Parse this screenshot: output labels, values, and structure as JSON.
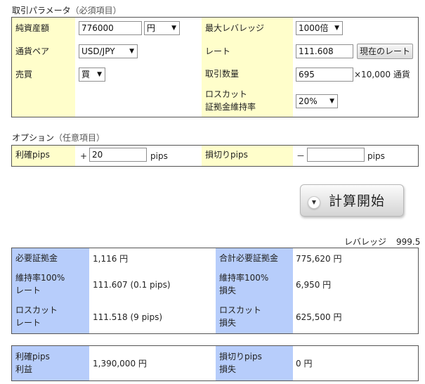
{
  "params_section": {
    "title": "取引パラメータ",
    "note": "（必須項目）"
  },
  "params": {
    "net_assets": {
      "label": "純資産額",
      "value": "776000",
      "unit": "円"
    },
    "max_leverage": {
      "label": "最大レバレッジ",
      "value": "1000倍"
    },
    "currency_pair": {
      "label": "通貨ペア",
      "value": "USD/JPY"
    },
    "rate": {
      "label": "レート",
      "value": "111.608",
      "button": "現在のレート"
    },
    "side": {
      "label": "売買",
      "value": "買"
    },
    "volume": {
      "label": "取引数量",
      "value": "695",
      "unit": "×10,000 通貨"
    },
    "losscut": {
      "label_line1": "ロスカット",
      "label_line2": "証拠金維持率",
      "value": "20%"
    }
  },
  "options_section": {
    "title": "オプション",
    "note": "（任意項目）"
  },
  "options": {
    "take_profit": {
      "label": "利確pips",
      "sign": "+",
      "value": "20",
      "unit": "pips"
    },
    "stop_loss": {
      "label": "損切りpips",
      "sign": "－",
      "value": "",
      "unit": "pips"
    }
  },
  "calc_button": "計算開始",
  "leverage_result": {
    "label": "レバレッジ",
    "value": "999.5"
  },
  "results": {
    "required_margin": {
      "label": "必要証拠金",
      "value": "1,116 円"
    },
    "total_required_margin": {
      "label": "合計必要証拠金",
      "value": "775,620 円"
    },
    "maint100_rate": {
      "label_line1": "維持率100%",
      "label_line2": "レート",
      "value": "111.607 (0.1 pips)"
    },
    "maint100_loss": {
      "label_line1": "維持率100%",
      "label_line2": "損失",
      "value": "6,950 円"
    },
    "losscut_rate": {
      "label_line1": "ロスカット",
      "label_line2": "レート",
      "value": "111.518 (9 pips)"
    },
    "losscut_loss": {
      "label_line1": "ロスカット",
      "label_line2": "損失",
      "value": "625,500 円"
    }
  },
  "pips_results": {
    "take_profit": {
      "label_line1": "利確pips",
      "label_line2": "利益",
      "value": "1,390,000 円"
    },
    "stop_loss": {
      "label_line1": "損切りpips",
      "label_line2": "損失",
      "value": "0 円"
    }
  },
  "colors": {
    "label_bg": "#fffecb",
    "result_label_bg": "#b7cdfb",
    "border": "#555555"
  }
}
